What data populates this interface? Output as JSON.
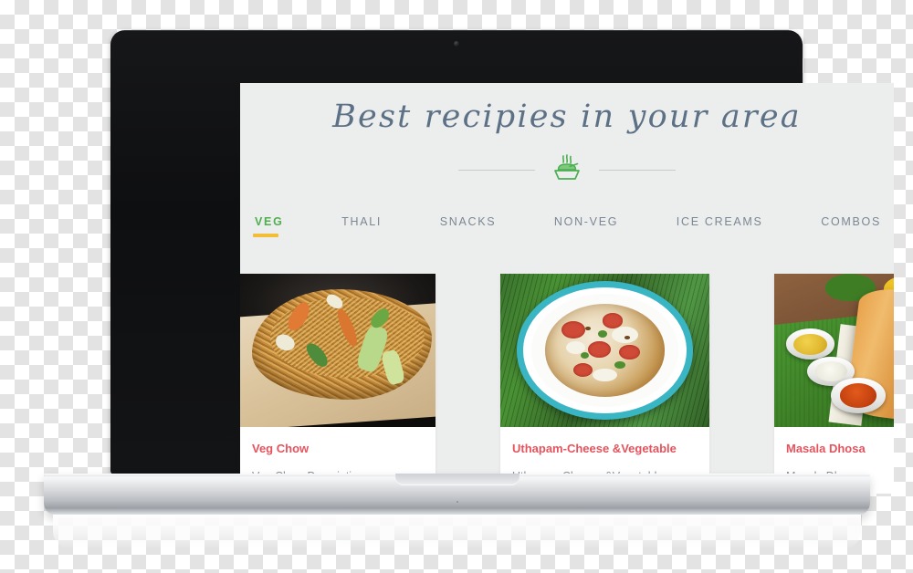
{
  "device": {
    "type": "laptop-mockup",
    "webcam": "webcam-dot"
  },
  "page": {
    "title": "Best recipies in your area",
    "title_color": "#5d7186",
    "background_color": "#eceded",
    "divider": {
      "icon": "bowl-of-food-icon",
      "icon_color": "#4caf50",
      "line_color": "#c9cbcb"
    }
  },
  "nav": {
    "active_color": "#50af4f",
    "inactive_color": "#7b8793",
    "underline_color": "#f2be38",
    "tabs": [
      {
        "label": "VEG",
        "active": true
      },
      {
        "label": "THALI",
        "active": false
      },
      {
        "label": "SNACKS",
        "active": false
      },
      {
        "label": "NON-VEG",
        "active": false
      },
      {
        "label": "ICE CREAMS",
        "active": false
      },
      {
        "label": "COMBOS",
        "active": false
      }
    ]
  },
  "cards": {
    "title_color": "#e6535d",
    "desc_color": "#8a9199",
    "items": [
      {
        "title": "Veg Chow",
        "description": "Veg Chow Description...",
        "image": "veg-chow-noodles-photo"
      },
      {
        "title": "Uthapam-Cheese &Vegetable",
        "description": "Uthapam-Cheese &Vegetable",
        "image": "uthapam-on-plate-photo"
      },
      {
        "title": "Masala Dhosa",
        "description": "Masala Dhosa",
        "image": "masala-dosa-photo"
      }
    ]
  }
}
